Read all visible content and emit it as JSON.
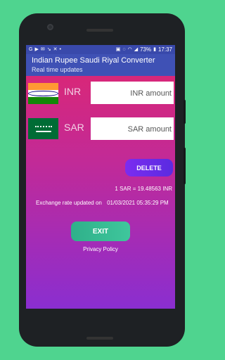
{
  "statusbar": {
    "left_icons": [
      "google-icon",
      "youtube-icon",
      "mail-icon",
      "missed-call-icon",
      "muted-icon",
      "more-icon"
    ],
    "right_icons": [
      "photo-icon",
      "mute-icon",
      "wifi-icon",
      "signal-icon"
    ],
    "battery": "73%",
    "time": "17:37"
  },
  "appbar": {
    "title": "Indian Rupee Saudi Riyal Converter",
    "subtitle": "Real time updates"
  },
  "converter": {
    "inr": {
      "code": "INR",
      "placeholder": "INR amount",
      "flag": "india-flag"
    },
    "sar": {
      "code": "SAR",
      "placeholder": "SAR amount",
      "flag": "saudi-flag"
    }
  },
  "actions": {
    "delete_label": "DELETE",
    "exit_label": "EXIT",
    "privacy_label": "Privacy Policy"
  },
  "rate": {
    "text": "1 SAR = 19.48563 INR",
    "updated_label": "Exchange rate updated on",
    "updated_value": "01/03/2021 05:35:29 PM"
  },
  "colors": {
    "background": "#4fd48f",
    "appbar": "#3f51b5",
    "gradient_top": "#e0266e",
    "gradient_bottom": "#8a2ed0",
    "delete_button": "#6a2ce8",
    "exit_button": "#36b892"
  }
}
